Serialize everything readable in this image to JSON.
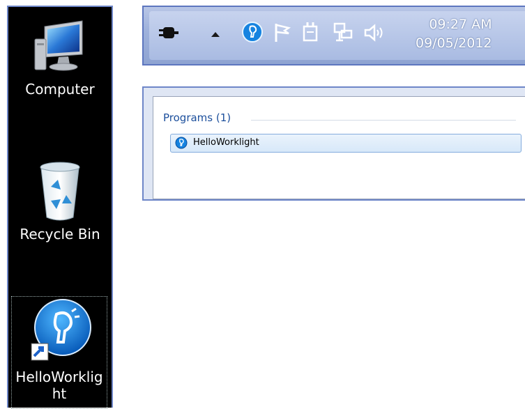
{
  "desktop": {
    "icons": [
      {
        "label": "Computer",
        "icon": "computer-icon"
      },
      {
        "label": "Recycle Bin",
        "icon": "recycle-bin-icon"
      },
      {
        "label_line1": "HelloWorklig",
        "label_line2": "ht",
        "icon": "worklight-app-icon"
      }
    ]
  },
  "tray": {
    "time": "09:27 AM",
    "date": "09/05/2012",
    "icons": [
      "power-plug-icon",
      "show-hidden-icons-arrow",
      "worklight-tray-icon",
      "action-center-flag-icon",
      "power-icon",
      "network-icon",
      "volume-icon"
    ]
  },
  "search_results": {
    "section": "Programs (1)",
    "items": [
      {
        "label": "HelloWorklight",
        "icon": "worklight-small-icon"
      }
    ]
  }
}
